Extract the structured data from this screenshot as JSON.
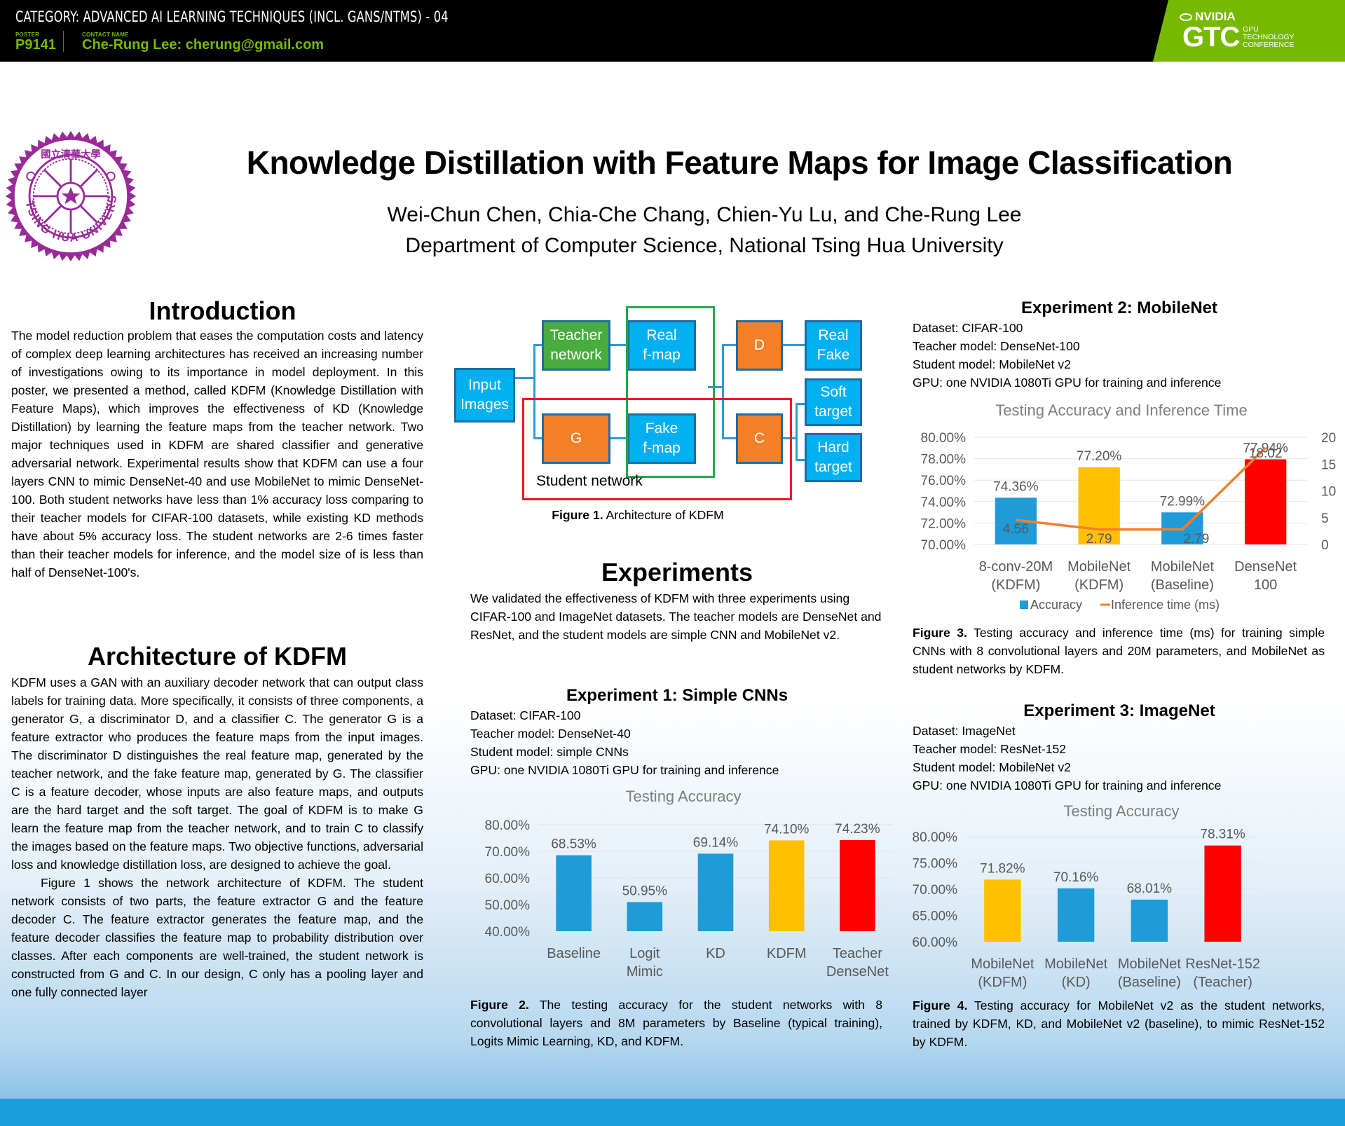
{
  "header": {
    "category": "CATEGORY: ADVANCED AI LEARNING TECHNIQUES (INCL. GANS/NTMS) - 04",
    "poster_label": "POSTER",
    "poster_id": "P9141",
    "contact_label": "CONTACT NAME",
    "contact": "Che-Rung Lee: cherung@gmail.com",
    "brand": {
      "nvidia": "NVIDIA",
      "gtc": "GTC",
      "gtc_sub": [
        "GPU",
        "TECHNOLOGY",
        "CONFERENCE"
      ]
    },
    "colors": {
      "bar": "#000000",
      "accent": "#76b900"
    }
  },
  "logo": {
    "name": "Tsing Hua University seal",
    "text": "TSING HUA UNIVERSITY",
    "color": "#8b1e8b"
  },
  "title": "Knowledge Distillation with Feature Maps for Image Classification",
  "authors": "Wei-Chun Chen, Chia-Che Chang, Chien-Yu Lu, and Che-Rung Lee",
  "affiliation": "Department of Computer Science, National Tsing Hua University",
  "introduction": {
    "heading": "Introduction",
    "text": "The model reduction problem that eases the computation costs and latency of complex deep learning architectures has received an increasing number of investigations owing to its importance in model deployment. In this poster, we presented a method, called KDFM (Knowledge Distillation with Feature Maps), which improves the effectiveness of KD (Knowledge Distillation) by learning the feature maps from the teacher network. Two major techniques used in KDFM are shared classifier and generative adversarial network. Experimental results show that KDFM can use a four layers CNN to mimic DenseNet-40 and use MobileNet to mimic DenseNet-100.  Both student networks have less than 1% accuracy loss comparing to their teacher models for CIFAR-100 datasets, while existing KD methods have about 5% accuracy loss. The student networks are 2-6 times faster than their teacher models for inference, and the model size of is less than half of DenseNet-100's."
  },
  "architecture": {
    "heading": "Architecture of KDFM",
    "text1": "KDFM uses a GAN with an auxiliary decoder network that can output class labels for training data.  More specifically, it consists of three components, a generator G, a discriminator D, and a classifier C.  The generator G is a feature extractor who produces the feature maps from the input images.  The discriminator D distinguishes the real feature map, generated by the teacher network, and the fake feature map, generated by G.  The classifier C is a feature decoder, whose inputs are also feature maps, and outputs are the hard target and the soft target.  The goal of KDFM is to make G learn the feature map from the teacher  network, and to train C to classify the images based on the feature maps. Two objective functions, adversarial loss and knowledge distillation loss, are designed to achieve the goal.",
    "text2": "Figure 1 shows the network architecture of KDFM.  The student network consists of two parts, the feature extractor G and the feature decoder C. The feature extractor generates the feature map, and the feature decoder classifies the feature map to probability distribution over classes.  After each components are well-trained, the student network is constructed from G and C.  In our design, C only has a pooling layer and one fully connected layer"
  },
  "figure1": {
    "nodes": {
      "input": "Input\nImages",
      "teacher": "Teacher\nnetwork",
      "real_fmap": "Real\nf-map",
      "g": "G",
      "fake_fmap": "Fake\nf-map",
      "d": "D",
      "c": "C",
      "real_fake": "Real\nFake",
      "soft": "Soft\ntarget",
      "hard": "Hard\ntarget"
    },
    "student_label": "Student network",
    "caption_bold": "Figure 1.",
    "caption": " Architecture of KDFM"
  },
  "experiments": {
    "heading": "Experiments",
    "text": "We validated the effectiveness of KDFM with three experiments using CIFAR-100 and ImageNet datasets.  The teacher models are DenseNet and ResNet, and the student models are simple CNN and MobileNet v2."
  },
  "exp1": {
    "heading": "Experiment 1: Simple CNNs",
    "details": [
      "Dataset: CIFAR-100",
      "Teacher model: DenseNet-40",
      "Student model: simple CNNs",
      "GPU: one NVIDIA 1080Ti GPU for training and inference"
    ],
    "caption_bold": "Figure 2.",
    "caption": " The testing accuracy for the student networks with 8 convolutional layers and 8M parameters by Baseline (typical training), Logits Mimic Learning, KD, and KDFM."
  },
  "exp2": {
    "heading": "Experiment 2: MobileNet",
    "details": [
      "Dataset: CIFAR-100",
      "Teacher model: DenseNet-100",
      "Student model: MobileNet v2",
      "GPU: one NVIDIA 1080Ti GPU for training and inference"
    ],
    "caption_bold": "Figure 3.",
    "caption": " Testing accuracy and inference time (ms) for training simple CNNs with 8 convolutional layers and 20M parameters, and MobileNet as student networks by KDFM."
  },
  "exp3": {
    "heading": "Experiment 3: ImageNet",
    "details": [
      "Dataset: ImageNet",
      "Teacher model: ResNet-152",
      "Student model: MobileNet v2",
      "GPU: one NVIDIA 1080Ti GPU for training and inference"
    ],
    "caption_bold": "Figure 4.",
    "caption": " Testing accuracy for MobileNet v2 as the student networks, trained by KDFM, KD, and MobileNet v2 (baseline), to mimic ResNet-152 by KDFM."
  },
  "chart_data": [
    {
      "id": "fig2",
      "type": "bar",
      "title": "Testing Accuracy",
      "categories": [
        [
          "Baseline"
        ],
        [
          "Logit",
          "Mimic"
        ],
        [
          "KD"
        ],
        [
          "KDFM"
        ],
        [
          "Teacher",
          "DenseNet"
        ]
      ],
      "values": [
        68.53,
        50.95,
        69.14,
        74.1,
        74.23
      ],
      "labels": [
        "68.53%",
        "50.95%",
        "69.14%",
        "74.10%",
        "74.23%"
      ],
      "colors": [
        "#1f9bd7",
        "#1f9bd7",
        "#1f9bd7",
        "#ffc000",
        "#ff0000"
      ],
      "ylim": [
        40,
        80
      ],
      "yticks": [
        "40.00%",
        "50.00%",
        "60.00%",
        "70.00%",
        "80.00%"
      ],
      "grid": true
    },
    {
      "id": "fig3",
      "type": "bar",
      "title": "Testing Accuracy and Inference Time",
      "categories": [
        [
          "8-conv-20M",
          "(KDFM)"
        ],
        [
          "MobileNet",
          "(KDFM)"
        ],
        [
          "MobileNet",
          "(Baseline)"
        ],
        [
          "DenseNet",
          "100"
        ]
      ],
      "series": [
        {
          "name": "Accuracy",
          "type": "bar",
          "values": [
            74.36,
            77.2,
            72.99,
            77.94
          ],
          "labels": [
            "74.36%",
            "77.20%",
            "72.99%",
            "77.94%"
          ],
          "colors": [
            "#1f9bd7",
            "#ffc000",
            "#1f9bd7",
            "#ff0000"
          ],
          "axis": "left"
        },
        {
          "name": "Inference time (ms)",
          "type": "line",
          "values": [
            4.56,
            2.79,
            2.79,
            18.02
          ],
          "labels": [
            "4.56",
            "2.79",
            "2.79",
            "18.02"
          ],
          "color": "#f47f29",
          "axis": "right"
        }
      ],
      "ylim": [
        70,
        80
      ],
      "yticks": [
        "70.00%",
        "72.00%",
        "74.00%",
        "76.00%",
        "78.00%",
        "80.00%"
      ],
      "y2lim": [
        0,
        20
      ],
      "y2ticks": [
        "0",
        "5",
        "10",
        "15",
        "20"
      ],
      "legend": [
        {
          "label": "Accuracy",
          "marker": "square",
          "color": "#1f9bd7"
        },
        {
          "label": "Inference time (ms)",
          "marker": "line",
          "color": "#f47f29"
        }
      ],
      "legend_position": "bottom",
      "grid": true
    },
    {
      "id": "fig4",
      "type": "bar",
      "title": "Testing Accuracy",
      "categories": [
        [
          "MobileNet",
          "(KDFM)"
        ],
        [
          "MobileNet",
          "(KD)"
        ],
        [
          "MobileNet",
          "(Baseline)"
        ],
        [
          "ResNet-152",
          "(Teacher)"
        ]
      ],
      "values": [
        71.82,
        70.16,
        68.01,
        78.31
      ],
      "labels": [
        "71.82%",
        "70.16%",
        "68.01%",
        "78.31%"
      ],
      "colors": [
        "#ffc000",
        "#1f9bd7",
        "#1f9bd7",
        "#ff0000"
      ],
      "ylim": [
        60,
        80
      ],
      "yticks": [
        "60.00%",
        "65.00%",
        "70.00%",
        "75.00%",
        "80.00%"
      ],
      "grid": true
    }
  ]
}
